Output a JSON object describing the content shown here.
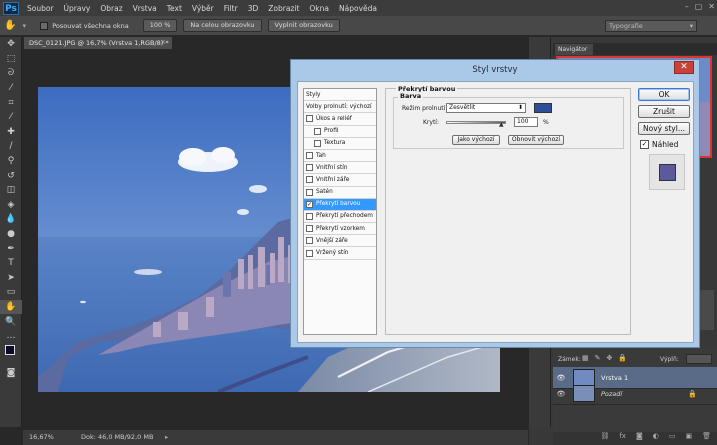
{
  "app": {
    "logo": "Ps"
  },
  "menu": [
    "Soubor",
    "Úpravy",
    "Obraz",
    "Vrstva",
    "Text",
    "Výběr",
    "Filtr",
    "3D",
    "Zobrazit",
    "Okna",
    "Nápověda"
  ],
  "options_bar": {
    "scroll_all_label": "Posouvat všechna okna",
    "zoom_button": "100 %",
    "fit_button": "Na celou obrazovku",
    "fill_button": "Vyplnit obrazovku",
    "workspace": "Typografie"
  },
  "document": {
    "tab_title": "DSC_0121.JPG @ 16,7% (Vrstva 1,RGB/8) *",
    "zoom": "16,67%",
    "doc_size": "Dok: 46,0 MB/92,0 MB"
  },
  "panels": {
    "navigator_tab": "Navigátor",
    "lock_label": "Zámek:",
    "fill_label": "Výplň:",
    "layers": [
      {
        "name": "Vrstva 1"
      },
      {
        "name": "Pozadí"
      }
    ]
  },
  "dialog": {
    "title": "Styl vrstvy",
    "close": "✕",
    "styles_list": [
      {
        "label": "Styly",
        "check": false
      },
      {
        "label": "Volby prolnutí: výchozí",
        "check": false
      },
      {
        "label": "Úkos a reliéf",
        "check": true
      },
      {
        "label": "Profil",
        "check": true,
        "indent": true
      },
      {
        "label": "Textura",
        "check": true,
        "indent": true
      },
      {
        "label": "Tah",
        "check": true
      },
      {
        "label": "Vnitřní stín",
        "check": true
      },
      {
        "label": "Vnitřní záře",
        "check": true
      },
      {
        "label": "Satén",
        "check": true
      },
      {
        "label": "Překrytí barvou",
        "check": true,
        "checked": true,
        "selected": true
      },
      {
        "label": "Překrytí přechodem",
        "check": true
      },
      {
        "label": "Překrytí vzorkem",
        "check": true
      },
      {
        "label": "Vnější záře",
        "check": true
      },
      {
        "label": "Vržený stín",
        "check": true
      }
    ],
    "section_title": "Překrytí barvou",
    "subsection_title": "Barva",
    "blend_mode_label": "Režim prolnutí:",
    "blend_mode_value": "Zesvětlit",
    "opacity_label": "Krytí:",
    "opacity_value": "100",
    "opacity_unit": "%",
    "make_default": "Jako výchozí",
    "reset_default": "Obnovit výchozí",
    "ok": "OK",
    "cancel": "Zrušit",
    "new_style": "Nový styl...",
    "preview_label": "Náhled",
    "preview_checked": true,
    "overlay_color": "#2d4f9a",
    "preview_swatch_color": "#5a5a9c"
  }
}
